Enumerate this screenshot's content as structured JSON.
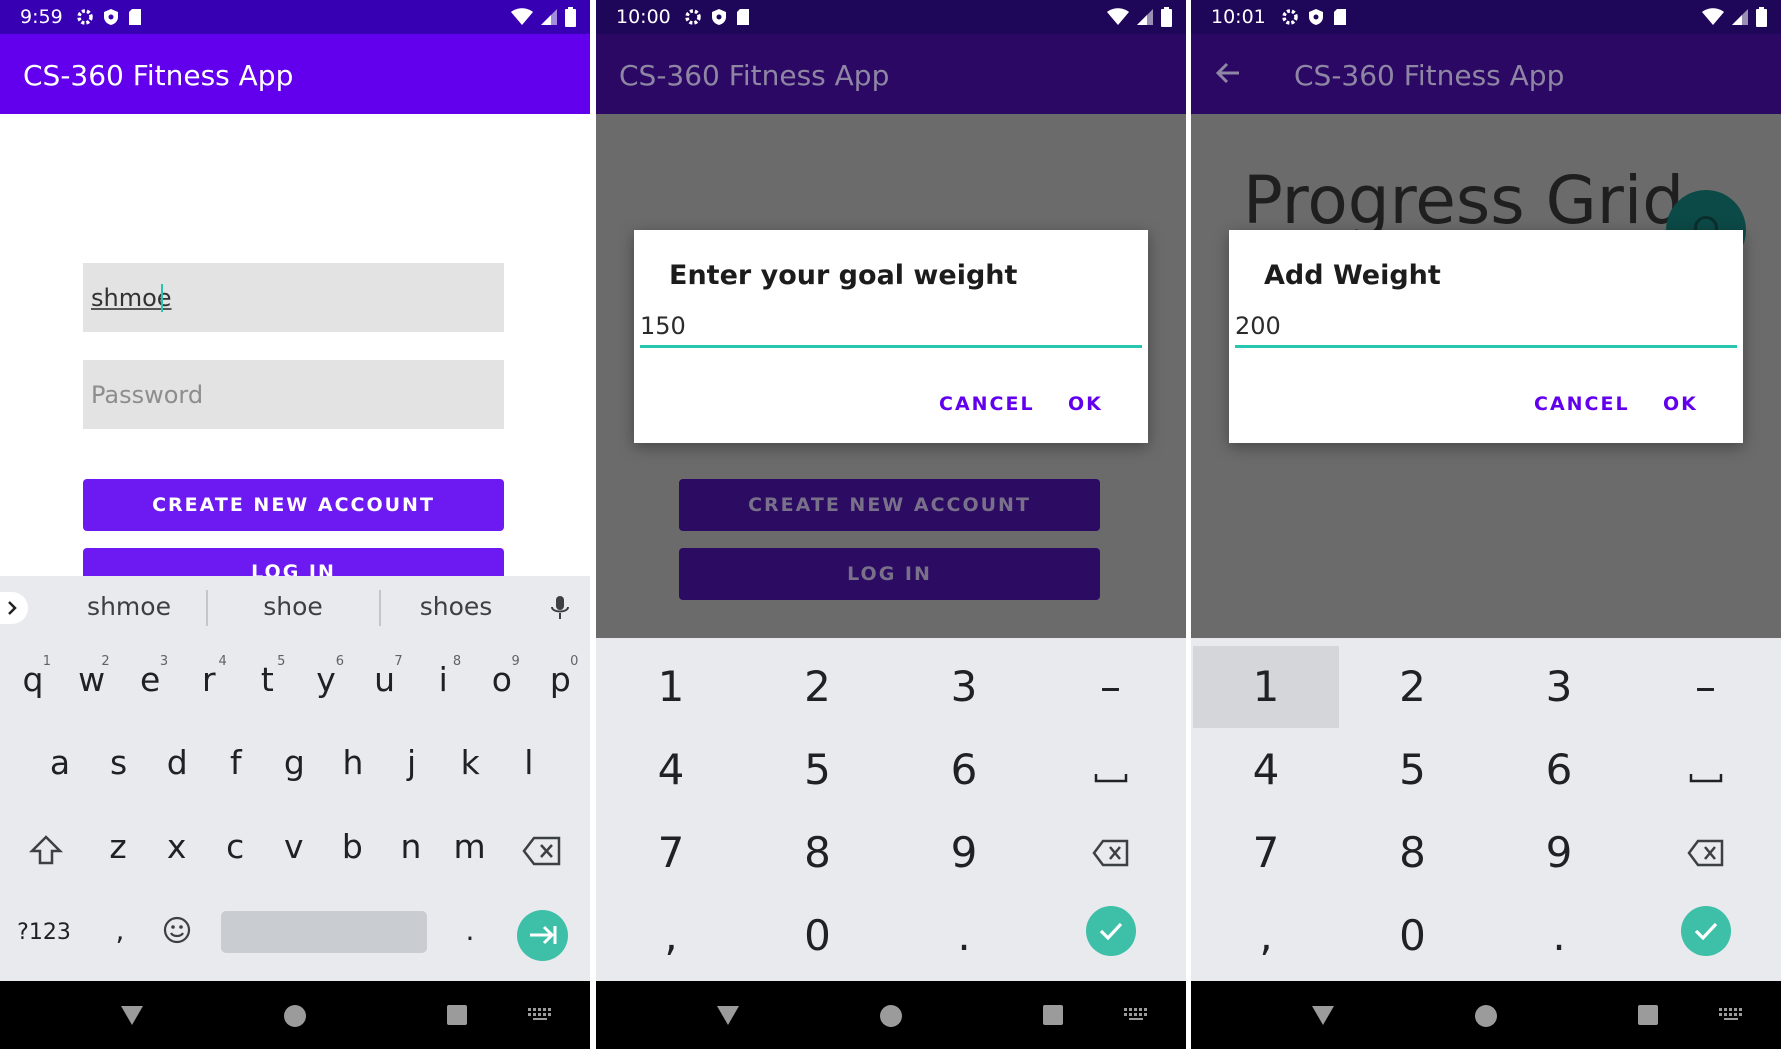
{
  "app_title": "CS-360 Fitness App",
  "colors": {
    "primary": "#6200ee",
    "status_bar": "#3700b3",
    "accent": "#26c6b1"
  },
  "screen1": {
    "time": "9:59",
    "username_value": "shmoe",
    "password_placeholder": "Password",
    "create_account_label": "CREATE NEW ACCOUNT",
    "login_label": "LOG IN",
    "suggestions": [
      "shmoe",
      "shoe",
      "shoes"
    ],
    "row1": [
      {
        "k": "q",
        "n": "1"
      },
      {
        "k": "w",
        "n": "2"
      },
      {
        "k": "e",
        "n": "3"
      },
      {
        "k": "r",
        "n": "4"
      },
      {
        "k": "t",
        "n": "5"
      },
      {
        "k": "y",
        "n": "6"
      },
      {
        "k": "u",
        "n": "7"
      },
      {
        "k": "i",
        "n": "8"
      },
      {
        "k": "o",
        "n": "9"
      },
      {
        "k": "p",
        "n": "0"
      }
    ],
    "row2": [
      "a",
      "s",
      "d",
      "f",
      "g",
      "h",
      "j",
      "k",
      "l"
    ],
    "row3": [
      "z",
      "x",
      "c",
      "v",
      "b",
      "n",
      "m"
    ],
    "symbols_key": "?123",
    "comma_key": ",",
    "period_key": "."
  },
  "screen2": {
    "time": "10:00",
    "dialog_title": "Enter your goal weight",
    "dialog_value": "150",
    "cancel_label": "CANCEL",
    "ok_label": "OK",
    "create_account_label": "CREATE NEW ACCOUNT",
    "login_label": "LOG IN"
  },
  "screen3": {
    "time": "10:01",
    "page_title": "Progress Grid",
    "dialog_title": "Add Weight",
    "dialog_value": "200",
    "cancel_label": "CANCEL",
    "ok_label": "OK"
  },
  "numpad_keys": [
    "1",
    "2",
    "3",
    "–",
    "4",
    "5",
    "6",
    "␣",
    "7",
    "8",
    "9",
    "⌫",
    ",",
    "0",
    ".",
    "✓"
  ],
  "icons": [
    "settings-icon",
    "shield-icon",
    "sd-card-icon",
    "wifi-icon",
    "signal-icon",
    "battery-icon",
    "back-arrow-icon",
    "mic-icon",
    "shift-icon",
    "backspace-icon",
    "emoji-icon",
    "check-icon",
    "nav-back-icon",
    "nav-home-icon",
    "nav-recents-icon",
    "keyboard-switch-icon"
  ]
}
